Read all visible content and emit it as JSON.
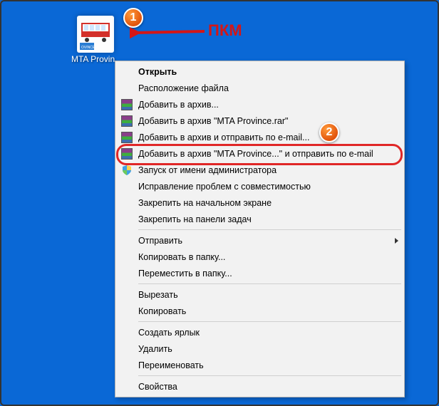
{
  "desktop": {
    "icon_label": "MTA Provin..."
  },
  "annotation": {
    "label": "ПКМ",
    "badge1": "1",
    "badge2": "2"
  },
  "menu": {
    "open": "Открыть",
    "file_location": "Расположение файла",
    "add_archive": "Добавить в архив...",
    "add_archive_named": "Добавить в архив \"MTA Province.rar\"",
    "add_send_email": "Добавить в архив и отправить по e-mail...",
    "add_named_send_email": "Добавить в архив \"MTA Province...\" и отправить по e-mail",
    "run_as_admin": "Запуск от имени администратора",
    "troubleshoot": "Исправление проблем с совместимостью",
    "pin_start": "Закрепить на начальном экране",
    "pin_taskbar": "Закрепить на панели задач",
    "send_to": "Отправить",
    "copy_to_folder": "Копировать в папку...",
    "move_to_folder": "Переместить в папку...",
    "cut": "Вырезать",
    "copy": "Копировать",
    "create_shortcut": "Создать ярлык",
    "delete": "Удалить",
    "rename": "Переименовать",
    "properties": "Свойства"
  }
}
